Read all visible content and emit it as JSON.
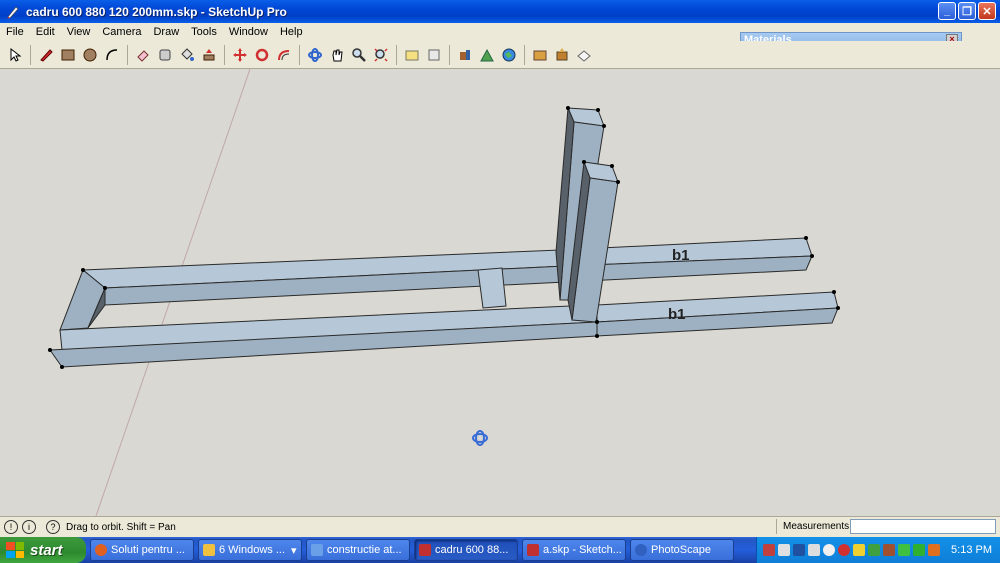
{
  "window": {
    "title": "cadru 600 880 120 200mm.skp - SketchUp Pro"
  },
  "menu": [
    "File",
    "Edit",
    "View",
    "Camera",
    "Draw",
    "Tools",
    "Window",
    "Help"
  ],
  "toolbar": {
    "icons": [
      "select-icon",
      "pencil-icon",
      "rectangle-icon",
      "circle-icon",
      "arc-icon",
      "eraser-icon",
      "tape-measure-icon",
      "paint-bucket-icon",
      "pushpull-icon",
      "move-icon",
      "rotate-icon",
      "offset-icon",
      "orbit-icon",
      "pan-icon",
      "zoom-icon",
      "zoom-extents-icon",
      "section-icon",
      "walk-icon",
      "components-icon",
      "warehouse-icon",
      "geo-icon",
      "texture-icon",
      "share-icon",
      "photo-icon"
    ]
  },
  "materials_panel": {
    "title": "Materials"
  },
  "model": {
    "labels": [
      "b1",
      "b1"
    ]
  },
  "status": {
    "hint": "Drag to orbit.  Shift = Pan",
    "measurements_label": "Measurements",
    "measurements_value": ""
  },
  "taskbar": {
    "start_label": "start",
    "tasks": [
      {
        "label": "Soluti pentru ...",
        "color": "#e06020"
      },
      {
        "label": "6 Windows ...",
        "color": "#f0c040"
      },
      {
        "label": "constructie at...",
        "color": "#6aa0e8"
      },
      {
        "label": "cadru 600 88...",
        "color": "#c03030",
        "active": true
      },
      {
        "label": "a.skp - Sketch...",
        "color": "#c03030"
      },
      {
        "label": "PhotoScape",
        "color": "#3060c0"
      }
    ],
    "clock": "5:13 PM"
  },
  "colors": {
    "viewport": "#d9d8d2",
    "beam_top": "#b6c8d8",
    "beam_side": "#9eb1c2",
    "beam_dark": "#58616a"
  }
}
